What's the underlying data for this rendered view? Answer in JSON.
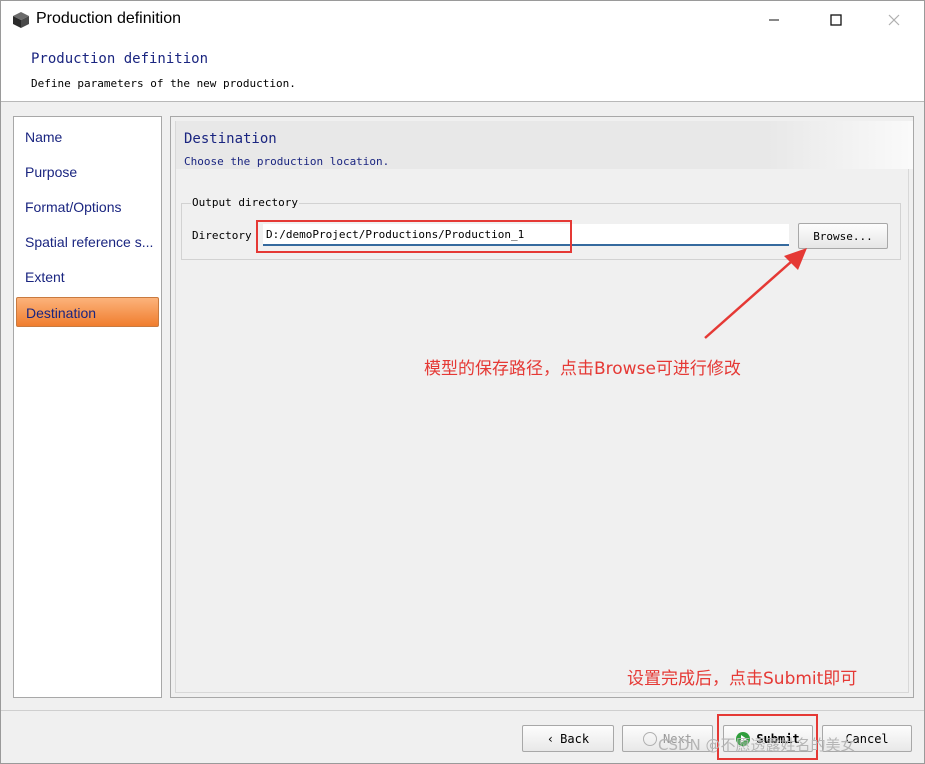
{
  "window": {
    "title": "Production definition",
    "app_icon": "cube-icon",
    "min_icon": "minimize-icon",
    "max_icon": "maximize-icon",
    "close_icon": "close-icon"
  },
  "header": {
    "title": "Production definition",
    "subtitle": "Define parameters of the new production."
  },
  "sidebar": {
    "items": [
      {
        "label": "Name",
        "active": false
      },
      {
        "label": "Purpose",
        "active": false
      },
      {
        "label": "Format/Options",
        "active": false
      },
      {
        "label": "Spatial reference s...",
        "active": false
      },
      {
        "label": "Extent",
        "active": false
      },
      {
        "label": "Destination",
        "active": true
      }
    ]
  },
  "content": {
    "title": "Destination",
    "subtitle": "Choose the production location.",
    "group_label": "Output directory",
    "directory_label": "Directory",
    "directory_value": "D:/demoProject/Productions/Production_1",
    "browse_label": "Browse..."
  },
  "footer": {
    "back_label": "Back",
    "next_label": "Next",
    "submit_label": "Submit",
    "cancel_label": "Cancel"
  },
  "annotations": {
    "note_1": "模型的保存路径，点击Browse可进行修改",
    "note_2": "设置完成后，点击Submit即可",
    "color": "#e53935"
  },
  "watermark": "CSDN @不愿透露姓名的美女",
  "colors": {
    "accent_text": "#1a2580",
    "active_item": "#f07d2e"
  }
}
